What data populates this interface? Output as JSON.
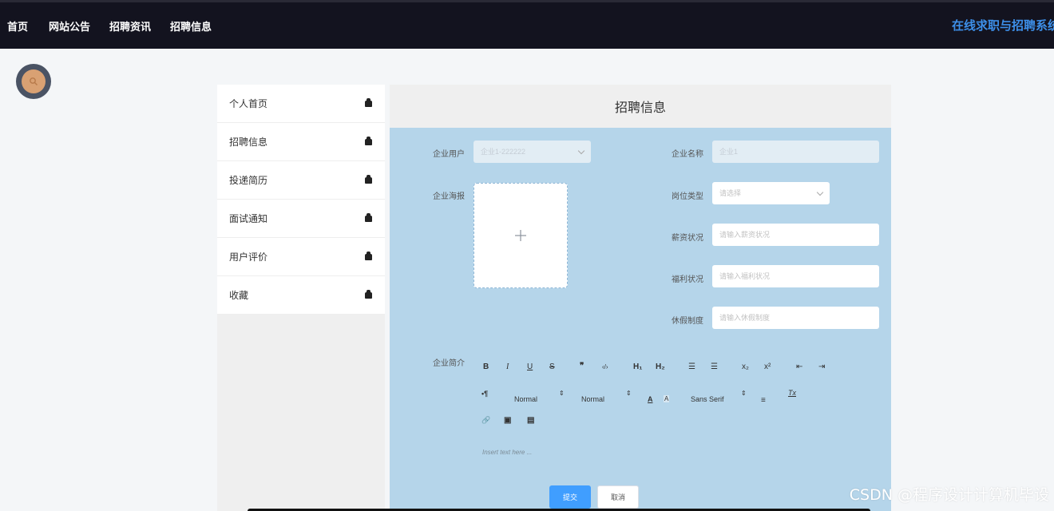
{
  "nav": {
    "items": [
      "首页",
      "网站公告",
      "招聘资讯",
      "招聘信息"
    ],
    "brand": "在线求职与招聘系统"
  },
  "sidebar": {
    "items": [
      "个人首页",
      "招聘信息",
      "投递简历",
      "面试通知",
      "用户评价",
      "收藏"
    ]
  },
  "panel": {
    "title": "招聘信息"
  },
  "form": {
    "company_user_label": "企业用户",
    "company_user_value": "企业1-222222",
    "company_name_label": "企业名称",
    "company_name_value": "企业1",
    "poster_label": "企业海报",
    "position_type_label": "岗位类型",
    "position_type_placeholder": "请选择",
    "salary_label": "薪资状况",
    "salary_placeholder": "请输入薪资状况",
    "welfare_label": "福利状况",
    "welfare_placeholder": "请输入福利状况",
    "vacation_label": "休假制度",
    "vacation_placeholder": "请输入休假制度",
    "intro_label": "企业简介"
  },
  "editor": {
    "bold": "B",
    "italic": "I",
    "underline": "U",
    "strike": "S",
    "blockquote": "❞",
    "code": "‹/›",
    "h1": "H₁",
    "h2": "H₂",
    "list_ordered": "☰",
    "list_bullet": "☰",
    "sub": "x₂",
    "sup": "x²",
    "indent_minus": "⇤",
    "indent_plus": "⇥",
    "direction": "•¶",
    "size_select": "Normal",
    "header_select": "Normal",
    "font_color": "A",
    "bg_color": "A",
    "font_select": "Sans Serif",
    "align": "≡",
    "clean": "Tx",
    "link": "🔗",
    "image": "▣",
    "video": "▤",
    "placeholder": "Insert text here ..."
  },
  "buttons": {
    "submit": "提交",
    "cancel": "取消"
  },
  "watermark": "CSDN @程序设计计算机毕设"
}
